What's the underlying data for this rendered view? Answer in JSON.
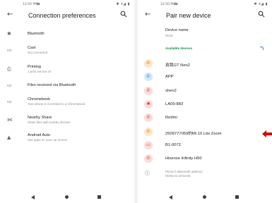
{
  "left": {
    "status": {
      "time": "12:50 PM",
      "sys": "✱ ▾◢ ▮"
    },
    "appbar": {
      "title": "Connection preferences"
    },
    "items": [
      {
        "title": "Bluetooth",
        "subtitle": "",
        "icon": "bluetooth-icon",
        "glyph": "✱"
      },
      {
        "title": "Cast",
        "subtitle": "Not connected",
        "icon": "cast-icon",
        "glyph": "▭"
      },
      {
        "title": "Printing",
        "subtitle": "1 print service on",
        "icon": "printer-icon",
        "glyph": "⎙"
      },
      {
        "title": "Files received via Bluetooth",
        "subtitle": "",
        "icon": "folder-icon",
        "glyph": "▭"
      },
      {
        "title": "Chromebook",
        "subtitle": "Your phone is not linked to a Chromebook",
        "icon": "chromebook-icon",
        "glyph": "▭"
      },
      {
        "title": "Nearby Share",
        "subtitle": "Share files with nearby devices",
        "icon": "nearby-share-icon",
        "glyph": "⋈"
      },
      {
        "title": "Android Auto",
        "subtitle": "Use apps on your car screen",
        "icon": "android-auto-icon",
        "glyph": "▲"
      }
    ]
  },
  "right": {
    "status": {
      "time": "12:50 PM",
      "sys": "✱ ▾◢ ▮"
    },
    "appbar": {
      "title": "Pair new device"
    },
    "device_name": {
      "label": "Device name",
      "value": "G615"
    },
    "available_label": "Available devices",
    "devices": [
      {
        "name": "真我GT Neo2",
        "type": "phone",
        "color": "#fde6c8",
        "fg": "#e8710a",
        "glyph": "✆"
      },
      {
        "name": "APP",
        "type": "phone",
        "color": "#d2e8fb",
        "fg": "#1a73e8",
        "glyph": "✆"
      },
      {
        "name": "shen2",
        "type": "phone",
        "color": "#fcdcd9",
        "fg": "#d93025",
        "glyph": "✆"
      },
      {
        "name": "LA09-883",
        "type": "bluetooth",
        "color": "#fcdcd9",
        "fg": "#d93025",
        "glyph": "✱"
      },
      {
        "name": "Redmi",
        "type": "phone",
        "color": "#fcdcd9",
        "fg": "#d93025",
        "glyph": "✆"
      },
      {
        "name": "2509777059的Mi 10 Lite Zoom",
        "type": "phone",
        "color": "#fde6c8",
        "fg": "#e8710a",
        "glyph": "✆"
      },
      {
        "name": "B1-0072",
        "type": "laptop",
        "color": "#fcdcd9",
        "fg": "#d93025",
        "glyph": "▭"
      },
      {
        "name": "Hisense Infinity H50",
        "type": "phone",
        "color": "#fcdcd9",
        "fg": "#d93025",
        "glyph": "✆"
      }
    ],
    "info": {
      "line1": "Phone's Bluetooth address:",
      "line2": "05:86:01:19:54:05"
    },
    "annotation_color": "#d50000"
  }
}
